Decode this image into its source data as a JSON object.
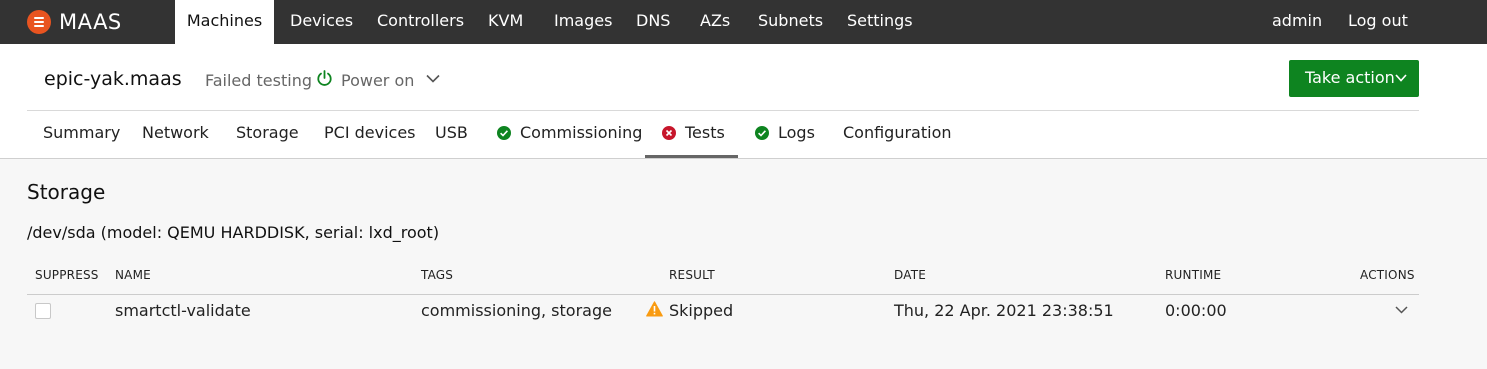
{
  "app": {
    "name": "MAAS"
  },
  "nav": {
    "items": [
      "Machines",
      "Devices",
      "Controllers",
      "KVM",
      "Images",
      "DNS",
      "AZs",
      "Subnets",
      "Settings"
    ],
    "user": "admin",
    "logout": "Log out"
  },
  "machine": {
    "hostname": "epic-yak.maas",
    "status": "Failed testing",
    "power": "Power on",
    "take_action": "Take action"
  },
  "tabs": [
    {
      "label": "Summary",
      "status": "none"
    },
    {
      "label": "Network",
      "status": "none"
    },
    {
      "label": "Storage",
      "status": "none"
    },
    {
      "label": "PCI devices",
      "status": "none"
    },
    {
      "label": "USB",
      "status": "none"
    },
    {
      "label": "Commissioning",
      "status": "passed"
    },
    {
      "label": "Tests",
      "status": "failed"
    },
    {
      "label": "Logs",
      "status": "passed"
    },
    {
      "label": "Configuration",
      "status": "none"
    }
  ],
  "colors": {
    "topbar": "#333333",
    "brand": "#e95420",
    "success": "#0e8420",
    "error": "#c7162b",
    "warning": "#f99b11"
  },
  "content": {
    "section_title": "Storage",
    "device_title": "/dev/sda (model: QEMU HARDDISK, serial: lxd_root)",
    "columns": [
      "SUPPRESS",
      "NAME",
      "TAGS",
      "RESULT",
      "DATE",
      "RUNTIME",
      "ACTIONS"
    ],
    "rows": [
      {
        "suppressed": false,
        "name": "smartctl-validate",
        "tags": "commissioning, storage",
        "result": "Skipped",
        "result_icon": "warning-icon",
        "date": "Thu, 22 Apr. 2021 23:38:51",
        "runtime": "0:00:00"
      }
    ]
  }
}
